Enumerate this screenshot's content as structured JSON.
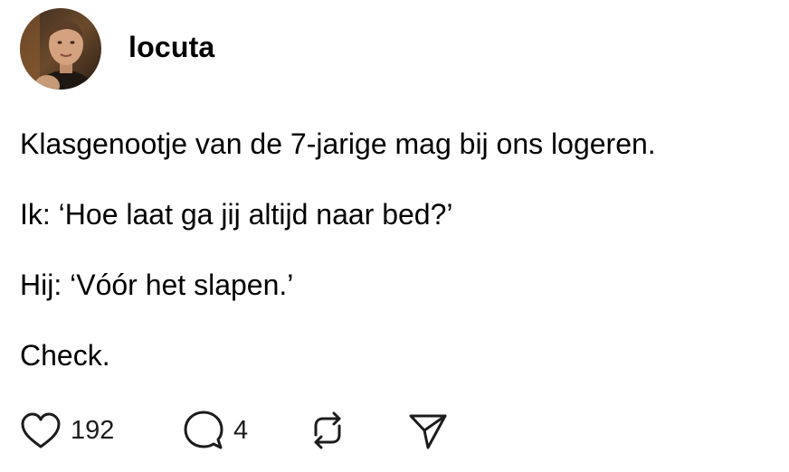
{
  "post": {
    "username": "locuta",
    "lines": [
      "Klasgenootje van de 7-jarige mag bij ons logeren.",
      "Ik: ‘Hoe laat ga jij altijd naar bed?’",
      "Hij: ‘Vóór het slapen.’",
      "Check."
    ],
    "actions": {
      "like_count": "192",
      "reply_count": "4",
      "like_icon": "heart-icon",
      "reply_icon": "speech-bubble-icon",
      "repost_icon": "repost-arrows-icon",
      "share_icon": "paper-plane-icon"
    }
  }
}
